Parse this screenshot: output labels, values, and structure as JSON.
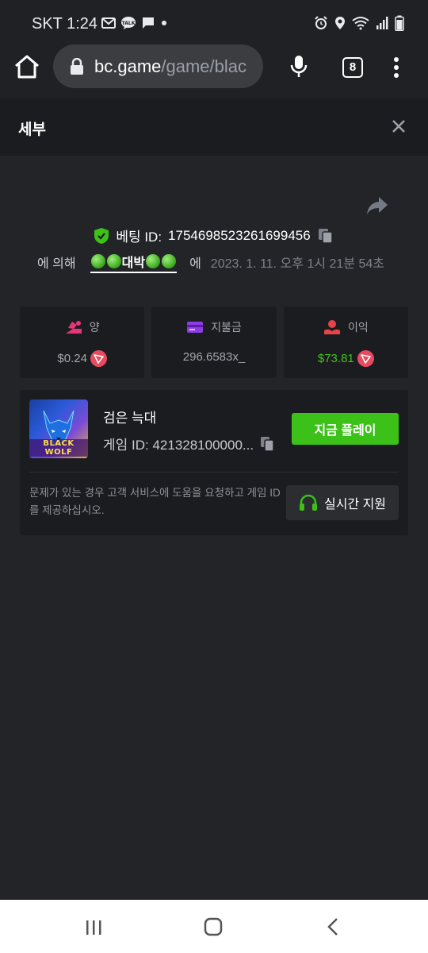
{
  "status_bar": {
    "carrier_time": "SKT 1:24",
    "icons_left": [
      "mail-icon",
      "talk-icon",
      "chat-icon",
      "dot-icon"
    ],
    "icons_right": [
      "alarm-icon",
      "location-icon",
      "wifi-icon",
      "signal-icon",
      "battery-icon"
    ]
  },
  "browser": {
    "url_host": "bc.game",
    "url_path": "/game/blac",
    "tab_count": "8"
  },
  "panel": {
    "title": "세부"
  },
  "bet": {
    "id_label": "베팅 ID:",
    "id_value": "1754698523261699456",
    "by_label": "에 의해",
    "username": "대박",
    "at_label": "에",
    "datetime": "2023. 1. 11. 오후 1시 21분 54초"
  },
  "stats": [
    {
      "label": "양",
      "value": "$0.24",
      "icon": "bet-amount-icon",
      "currency_icon": "tron-icon"
    },
    {
      "label": "지불금",
      "value": "296.6583x_",
      "icon": "payout-card-icon"
    },
    {
      "label": "이익",
      "value": "$73.81",
      "icon": "profit-icon",
      "currency_icon": "tron-icon"
    }
  ],
  "game": {
    "thumb_title": "BLACK WOLF",
    "name": "검은 늑대",
    "id_text": "게임 ID: 421328100000...",
    "play_label": "지금 플레이",
    "help_text": "문제가 있는 경우 고객 서비스에 도움을 요청하고 게임 ID를 제공하십시오.",
    "support_label": "실시간 지원"
  },
  "colors": {
    "page_bg": "#232428",
    "card_bg": "#1b1c1f",
    "accent_green": "#3bc117",
    "profit_green": "#43c41b",
    "tron_red": "#e84a5f"
  }
}
